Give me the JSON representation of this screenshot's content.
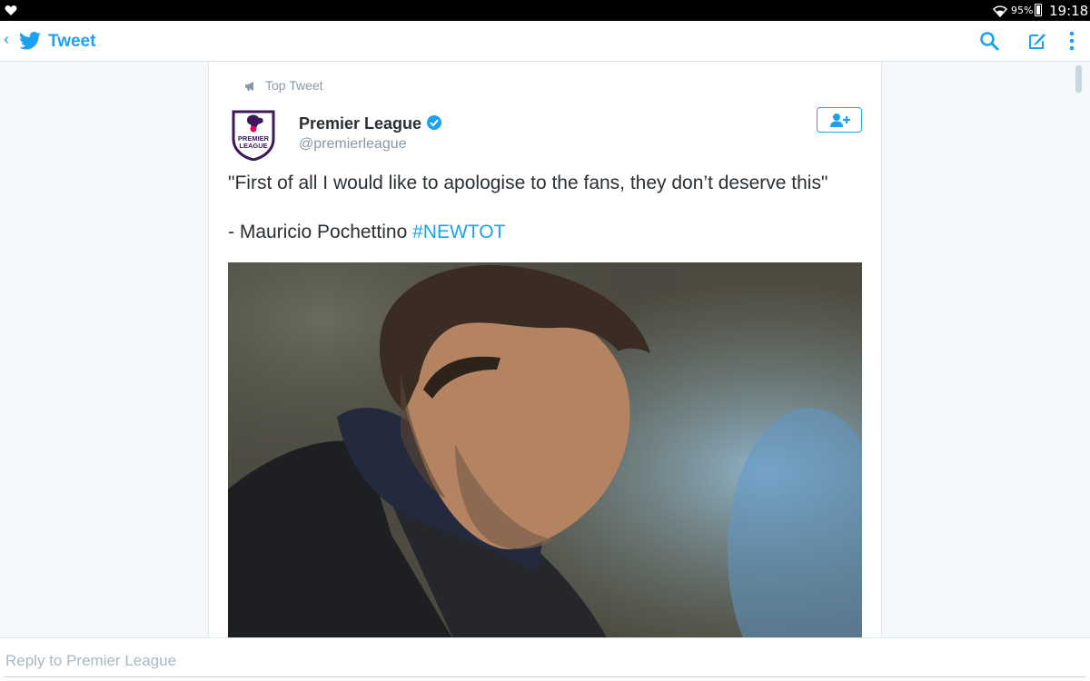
{
  "status_bar": {
    "battery_percent": "95%",
    "time": "19:18",
    "icons": [
      "heart-icon",
      "wifi-icon",
      "battery-icon"
    ]
  },
  "app_bar": {
    "back_icon": "back-chevron-icon",
    "logo_icon": "twitter-bird-icon",
    "title": "Tweet",
    "actions": [
      "search-icon",
      "compose-icon",
      "more-vert-icon"
    ]
  },
  "tweet": {
    "context_label": "Top Tweet",
    "author_name": "Premier League",
    "author_handle": "@premierleague",
    "verified": true,
    "avatar_text": "PREMIER LEAGUE",
    "text_line1": "\"First of all I would like to apologise to the fans, they don’t deserve this\"",
    "text_line2_prefix": "- Mauricio Pochettino ",
    "hashtag": "#NEWTOT",
    "follow_icon": "follow-user-icon"
  },
  "reply": {
    "placeholder": "Reply to Premier League"
  },
  "colors": {
    "accent": "#1da1f2",
    "muted": "#8899a6",
    "text": "#292f33"
  }
}
